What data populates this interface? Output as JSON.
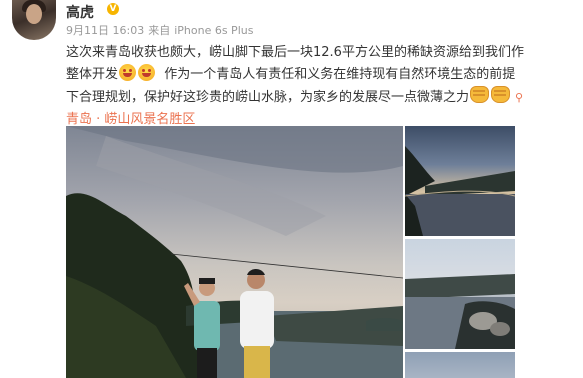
{
  "post": {
    "username": "高虎",
    "vip_badge": "V",
    "date": "9月11日 16:03",
    "source_prefix": "来自",
    "source": "iPhone 6s Plus",
    "text_part1": "这次来青岛收获也颇大，崂山脚下最后一块12.6平方公里的稀缺资源给到我们作整体开发",
    "text_part2": "作为一个青岛人有责任和义务在维持现有自然环境生态的前提下合理规划，保护好这珍贵的崂山水脉，为家乡的发展尽一点微薄之力",
    "location": "青岛 · 崂山风景名胜区",
    "icons": {
      "emoji": "smile-emoji-icon",
      "fist": "fist-emoji-icon",
      "location": "location-pin-icon"
    }
  }
}
